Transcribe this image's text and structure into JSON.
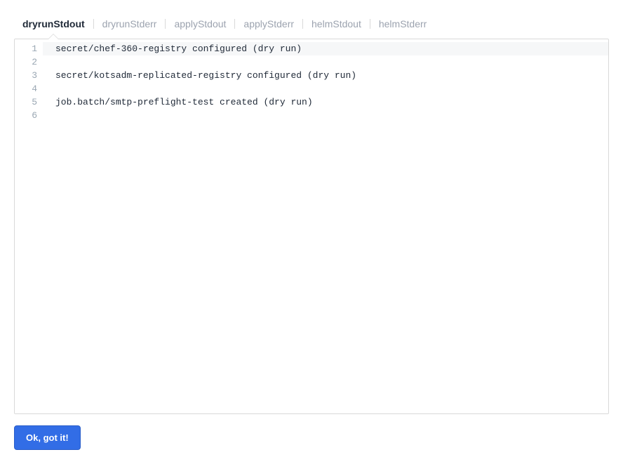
{
  "tabs": [
    {
      "id": "dryrunStdout",
      "label": "dryrunStdout",
      "active": true
    },
    {
      "id": "dryrunStderr",
      "label": "dryrunStderr",
      "active": false
    },
    {
      "id": "applyStdout",
      "label": "applyStdout",
      "active": false
    },
    {
      "id": "applyStderr",
      "label": "applyStderr",
      "active": false
    },
    {
      "id": "helmStdout",
      "label": "helmStdout",
      "active": false
    },
    {
      "id": "helmStderr",
      "label": "helmStderr",
      "active": false
    }
  ],
  "editor": {
    "lines": [
      "secret/chef-360-registry configured (dry run)",
      "",
      "secret/kotsadm-replicated-registry configured (dry run)",
      "",
      "job.batch/smtp-preflight-test created (dry run)",
      ""
    ],
    "highlighted_line_index": 0
  },
  "footer": {
    "ok_label": "Ok, got it!"
  }
}
